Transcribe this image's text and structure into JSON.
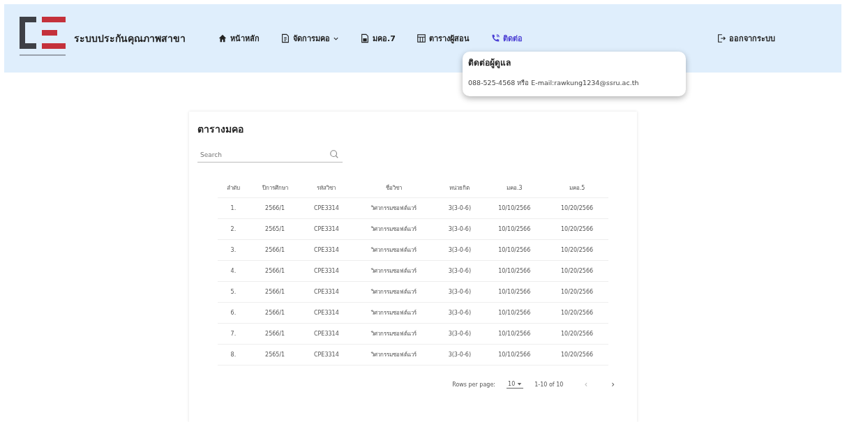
{
  "header": {
    "title": "ระบบประกันคุณภาพสาขา",
    "nav": [
      {
        "label": "หน้าหลัก",
        "kind": "home",
        "selected": false,
        "dropdown": false
      },
      {
        "label": "จัดการมคอ",
        "kind": "doc",
        "selected": false,
        "dropdown": true
      },
      {
        "label": "มคอ.7",
        "kind": "file",
        "selected": false,
        "dropdown": false
      },
      {
        "label": "ตารางผู้สอน",
        "kind": "table",
        "selected": false,
        "dropdown": false
      },
      {
        "label": "ติดต่อ",
        "kind": "phone",
        "selected": true,
        "dropdown": false
      }
    ],
    "logout": "ออกจากระบบ"
  },
  "contact_popup": {
    "title": "ติดต่อผู้ดูแล",
    "text": "088-525-4568 หรือ E-mail:rawkung1234@ssru.ac.th"
  },
  "card": {
    "title": "ตารางมคอ",
    "search": {
      "placeholder": "Search"
    },
    "table": {
      "columns": [
        "ลำดับ",
        "ปีการศึกษา",
        "รหัสวิชา",
        "ชื่อวิชา",
        "หน่วยกิต",
        "มคอ.3",
        "มคอ.5"
      ],
      "rows": [
        [
          "1.",
          "2566/1",
          "CPE3314",
          "วิศวกรรมซอฟต์แวร์",
          "3(3-0-6)",
          "10/10/2566",
          "10/20/2566"
        ],
        [
          "2.",
          "2565/1",
          "CPE3314",
          "วิศวกรรมซอฟต์แวร์",
          "3(3-0-6)",
          "10/10/2566",
          "10/20/2566"
        ],
        [
          "3.",
          "2566/1",
          "CPE3314",
          "วิศวกรรมซอฟต์แวร์",
          "3(3-0-6)",
          "10/10/2566",
          "10/20/2566"
        ],
        [
          "4.",
          "2566/1",
          "CPE3314",
          "วิศวกรรมซอฟต์แวร์",
          "3(3-0-6)",
          "10/10/2566",
          "10/20/2566"
        ],
        [
          "5.",
          "2566/1",
          "CPE3314",
          "วิศวกรรมซอฟต์แวร์",
          "3(3-0-6)",
          "10/10/2566",
          "10/20/2566"
        ],
        [
          "6.",
          "2566/1",
          "CPE3314",
          "วิศวกรรมซอฟต์แวร์",
          "3(3-0-6)",
          "10/10/2566",
          "10/20/2566"
        ],
        [
          "7.",
          "2566/1",
          "CPE3314",
          "วิศวกรรมซอฟต์แวร์",
          "3(3-0-6)",
          "10/10/2566",
          "10/20/2566"
        ],
        [
          "8.",
          "2565/1",
          "CPE3314",
          "วิศวกรรมซอฟต์แวร์",
          "3(3-0-6)",
          "10/10/2566",
          "10/20/2566"
        ]
      ]
    },
    "pagination": {
      "rows_label": "Rows per page:",
      "rows_value": "10",
      "range": "1-10 of 10",
      "prev": "‹",
      "next": "›"
    }
  }
}
